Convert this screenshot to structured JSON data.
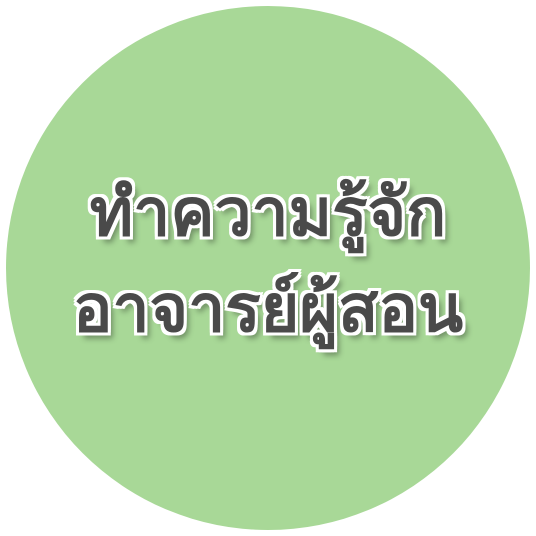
{
  "badge": {
    "line1": "ทำความรู้จัก",
    "line2": "อาจารย์ผู้สอน",
    "background_color": "#a8d897",
    "text_color": "#4a4a4a",
    "outline_color": "#ffffff"
  }
}
